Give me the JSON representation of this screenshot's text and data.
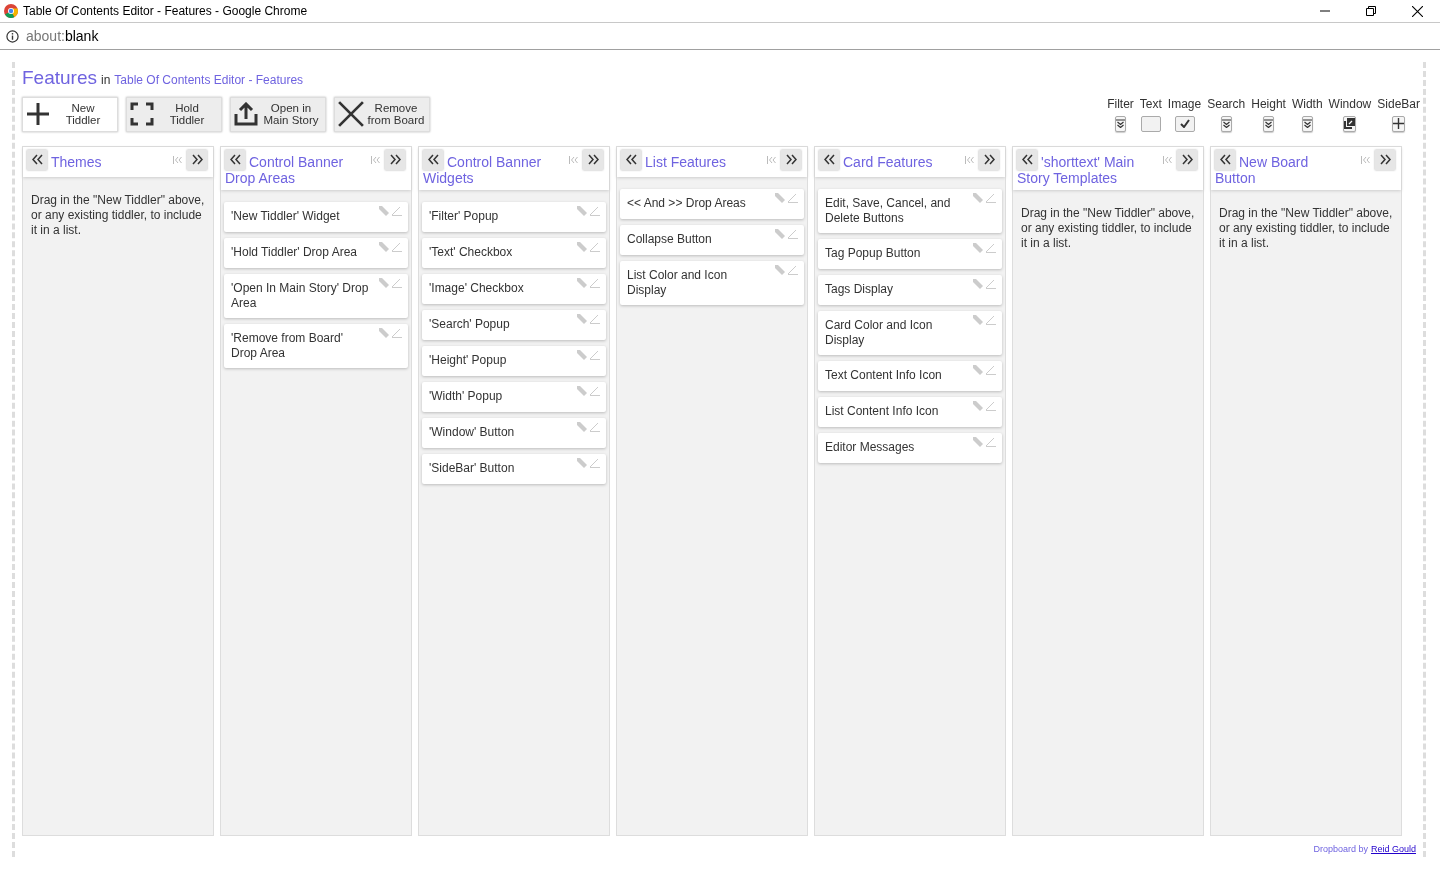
{
  "window": {
    "title": "Table Of Contents Editor - Features - Google Chrome"
  },
  "address_bar": {
    "scheme": "about:",
    "rest": "blank"
  },
  "header": {
    "title": "Features",
    "connector": "in",
    "parent_link": "Table Of Contents Editor - Features"
  },
  "action_buttons": [
    {
      "kind": "plus",
      "label_lines": [
        "New",
        "Tiddler"
      ]
    },
    {
      "kind": "corners",
      "label_lines": [
        "Hold",
        "Tiddler"
      ]
    },
    {
      "kind": "upload",
      "label_lines": [
        "Open in",
        "Main Story"
      ]
    },
    {
      "kind": "cross",
      "label_lines": [
        "Remove",
        "from Board"
      ]
    }
  ],
  "view_controls": [
    {
      "label": "Filter",
      "kind": "dropdown"
    },
    {
      "label": "Text",
      "kind": "checkbox",
      "checked": false
    },
    {
      "label": "Image",
      "kind": "checkbox",
      "checked": true
    },
    {
      "label": "Search",
      "kind": "dropdown"
    },
    {
      "label": "Height",
      "kind": "dropdown"
    },
    {
      "label": "Width",
      "kind": "dropdown"
    },
    {
      "label": "Window",
      "kind": "window"
    },
    {
      "label": "SideBar",
      "kind": "plus"
    }
  ],
  "lists": [
    {
      "title": "Themes",
      "empty_message": "Drag in the \"New Tiddler\" above, or any existing tiddler, to include it in a list."
    },
    {
      "title": "Control Banner Drop Areas",
      "cards": [
        "'New Tiddler' Widget",
        "'Hold Tiddler' Drop Area",
        "'Open In Main Story' Drop Area",
        "'Remove from Board' Drop Area"
      ]
    },
    {
      "title": "Control Banner Widgets",
      "cards": [
        "'Filter' Popup",
        "'Text' Checkbox",
        "'Image' Checkbox",
        "'Search' Popup",
        "'Height' Popup",
        "'Width' Popup",
        "'Window' Button",
        "'SideBar' Button"
      ]
    },
    {
      "title": "List Features",
      "cards": [
        "<< And >> Drop Areas",
        "Collapse Button",
        "List Color and Icon Display"
      ]
    },
    {
      "title": "Card Features",
      "cards": [
        "Edit, Save, Cancel, and Delete Buttons",
        "Tag Popup Button",
        "Tags Display",
        "Card Color and Icon Display",
        "Text Content Info Icon",
        "List Content Info Icon",
        "Editor Messages"
      ]
    },
    {
      "title": "'shorttext' Main Story Templates",
      "empty_message": "Drag in the \"New Tiddler\" above, or any existing tiddler, to include it in a list."
    },
    {
      "title": "New Board Button",
      "empty_message": "Drag in the \"New Tiddler\" above, or any existing tiddler, to include it in a list."
    }
  ],
  "footer": {
    "text": "Dropboard by",
    "link": "Reid Gould"
  }
}
